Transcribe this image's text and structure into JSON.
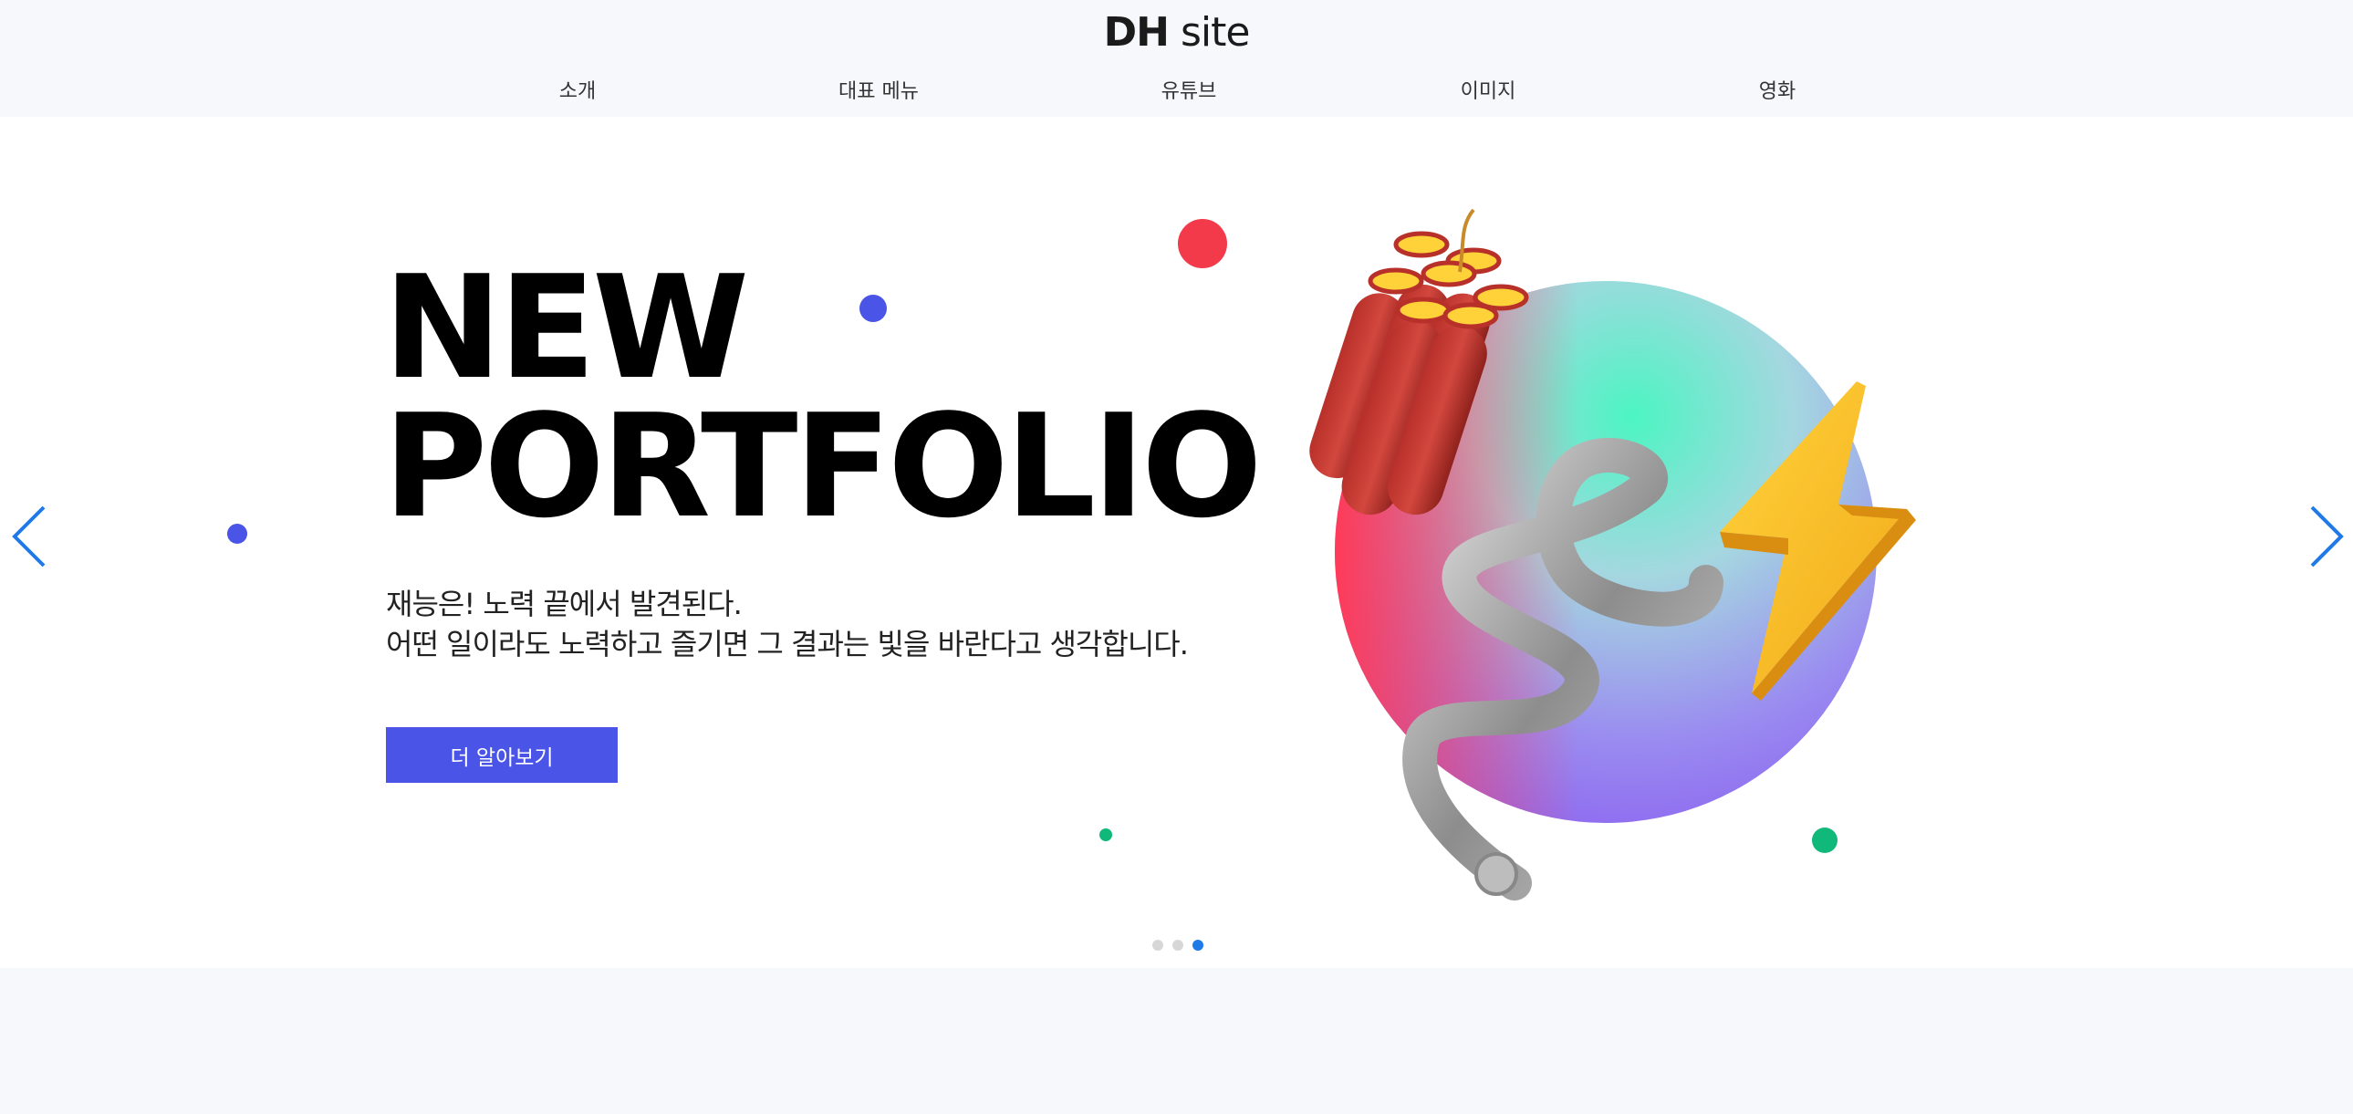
{
  "header": {
    "logo_bold": "DH",
    "logo_rest": "site",
    "nav": [
      "소개",
      "대표 메뉴",
      "유튜브",
      "이미지",
      "영화"
    ]
  },
  "hero": {
    "headline_line1": "NEW",
    "headline_line2": "PORTFOLIO",
    "desc_line1": "재능은! 노력 끝에서 발견된다.",
    "desc_line2": "어떤 일이라도 노력하고 즐기면 그 결과는 빛을 바란다고 생각합니다.",
    "cta_label": "더 알아보기"
  },
  "pagination": {
    "count": 3,
    "active_index": 2
  },
  "icons": {
    "prev": "chevron-left-icon",
    "next": "chevron-right-icon"
  },
  "colors": {
    "accent_blue": "#4a54e6",
    "arrow_blue": "#1f7ae8",
    "red_dot": "#f23a4a",
    "green_dot": "#10b97a",
    "page_bg": "#f7f8fc"
  }
}
